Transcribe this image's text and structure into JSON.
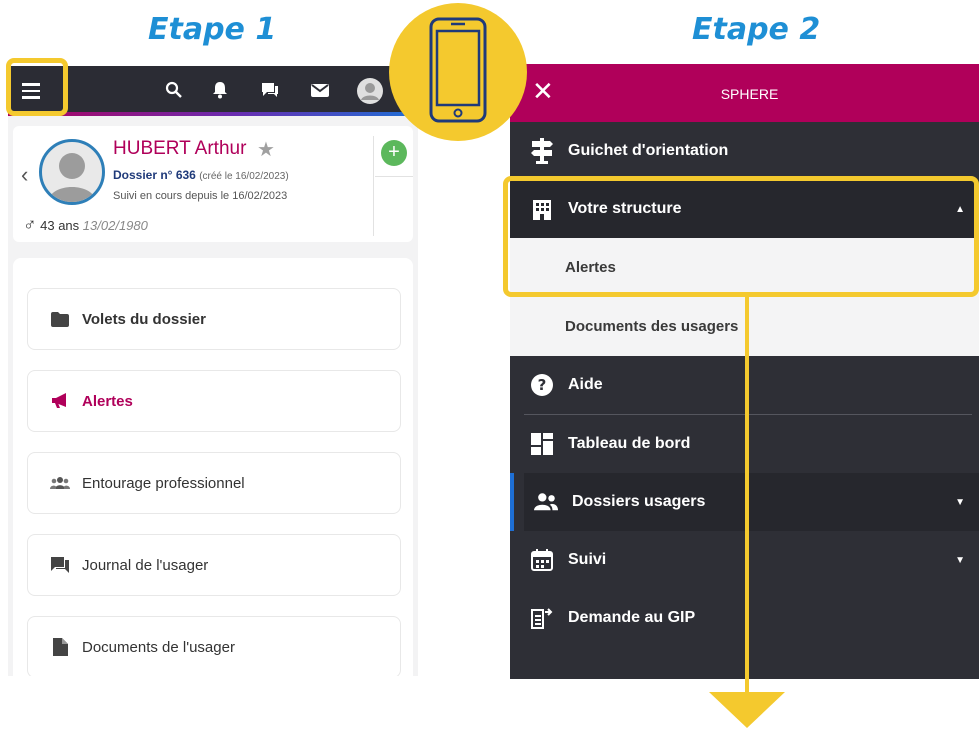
{
  "steps": {
    "step1": "Etape 1",
    "step2": "Etape 2"
  },
  "left_screen": {
    "topbar_icons": [
      "menu-icon",
      "search-icon",
      "bell-icon",
      "chat-icon",
      "mail-icon",
      "user-avatar-icon"
    ],
    "patient": {
      "name": "HUBERT Arthur",
      "dossier_label": "Dossier n° 636",
      "dossier_created": "(créé le 16/02/2023)",
      "suivi": "Suivi en cours depuis le 16/02/2023",
      "gender_symbol": "♂",
      "age": "43 ans",
      "birthdate": "13/02/1980",
      "add_button": "+"
    },
    "menu": [
      {
        "label": "Volets du dossier",
        "icon": "folder-icon",
        "active": false
      },
      {
        "label": "Alertes",
        "icon": "megaphone-icon",
        "active": true
      },
      {
        "label": "Entourage professionnel",
        "icon": "group-icon",
        "active": false
      },
      {
        "label": "Journal de l'usager",
        "icon": "comments-icon",
        "active": false
      },
      {
        "label": "Documents de l'usager",
        "icon": "file-icon",
        "active": false
      }
    ]
  },
  "right_screen": {
    "close_label": "✕",
    "app_title": "SPHERE",
    "items": {
      "guichet": "Guichet d'orientation",
      "structure": "Votre structure",
      "alertes": "Alertes",
      "documents": "Documents des usagers",
      "aide": "Aide",
      "tableau": "Tableau de bord",
      "dossiers": "Dossiers usagers",
      "suivi": "Suivi",
      "demande": "Demande au GIP"
    }
  },
  "colors": {
    "brand": "#b0005a",
    "highlight": "#f4c92e",
    "step_title": "#1e8fd5",
    "dark_bg": "#2e2f36",
    "add_green": "#5cb85c"
  }
}
